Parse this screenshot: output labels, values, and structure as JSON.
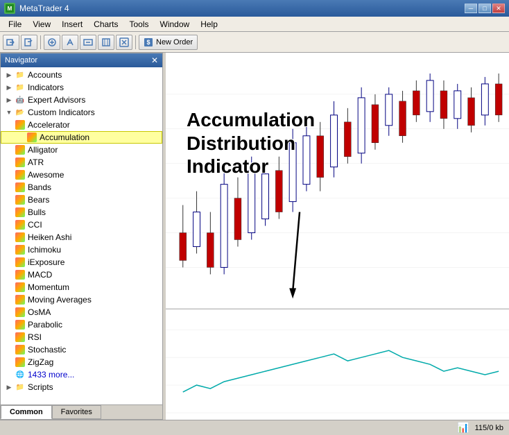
{
  "app": {
    "title": "MetaTrader 4",
    "icon": "MT4"
  },
  "titleBar": {
    "title": "MetaTrader 4",
    "minimizeLabel": "─",
    "maximizeLabel": "□",
    "closeLabel": "✕"
  },
  "menuBar": {
    "items": [
      "File",
      "View",
      "Insert",
      "Charts",
      "Tools",
      "Window",
      "Help"
    ]
  },
  "toolbar": {
    "newOrderLabel": "New Order"
  },
  "navigator": {
    "title": "Navigator",
    "closeLabel": "✕",
    "tabs": [
      "Common",
      "Favorites"
    ],
    "activeTab": "Common",
    "tree": [
      {
        "id": "accounts",
        "label": "Accounts",
        "level": 0,
        "type": "folder",
        "expanded": true
      },
      {
        "id": "indicators",
        "label": "Indicators",
        "level": 0,
        "type": "folder",
        "expanded": false
      },
      {
        "id": "expert-advisors",
        "label": "Expert Advisors",
        "level": 0,
        "type": "folder",
        "expanded": false
      },
      {
        "id": "custom-indicators",
        "label": "Custom Indicators",
        "level": 0,
        "type": "folder",
        "expanded": true
      },
      {
        "id": "accelerator",
        "label": "Accelerator",
        "level": 1,
        "type": "indicator"
      },
      {
        "id": "accumulation",
        "label": "Accumulation",
        "level": 1,
        "type": "indicator",
        "highlighted": true
      },
      {
        "id": "alligator",
        "label": "Alligator",
        "level": 1,
        "type": "indicator"
      },
      {
        "id": "atr",
        "label": "ATR",
        "level": 1,
        "type": "indicator"
      },
      {
        "id": "awesome",
        "label": "Awesome",
        "level": 1,
        "type": "indicator"
      },
      {
        "id": "bands",
        "label": "Bands",
        "level": 1,
        "type": "indicator"
      },
      {
        "id": "bears",
        "label": "Bears",
        "level": 1,
        "type": "indicator"
      },
      {
        "id": "bulls",
        "label": "Bulls",
        "level": 1,
        "type": "indicator"
      },
      {
        "id": "cci",
        "label": "CCI",
        "level": 1,
        "type": "indicator"
      },
      {
        "id": "heiken-ashi",
        "label": "Heiken Ashi",
        "level": 1,
        "type": "indicator"
      },
      {
        "id": "ichimoku",
        "label": "Ichimoku",
        "level": 1,
        "type": "indicator"
      },
      {
        "id": "iexposure",
        "label": "iExposure",
        "level": 1,
        "type": "indicator"
      },
      {
        "id": "macd",
        "label": "MACD",
        "level": 1,
        "type": "indicator"
      },
      {
        "id": "momentum",
        "label": "Momentum",
        "level": 1,
        "type": "indicator"
      },
      {
        "id": "moving-averages",
        "label": "Moving Averages",
        "level": 1,
        "type": "indicator"
      },
      {
        "id": "osma",
        "label": "OsMA",
        "level": 1,
        "type": "indicator"
      },
      {
        "id": "parabolic",
        "label": "Parabolic",
        "level": 1,
        "type": "indicator"
      },
      {
        "id": "rsi",
        "label": "RSI",
        "level": 1,
        "type": "indicator"
      },
      {
        "id": "stochastic",
        "label": "Stochastic",
        "level": 1,
        "type": "indicator"
      },
      {
        "id": "zigzag",
        "label": "ZigZag",
        "level": 1,
        "type": "indicator"
      },
      {
        "id": "more",
        "label": "1433 more...",
        "level": 1,
        "type": "more"
      },
      {
        "id": "scripts",
        "label": "Scripts",
        "level": 0,
        "type": "folder",
        "expanded": false
      }
    ]
  },
  "chart": {
    "annotation": {
      "line1": "Accumulation",
      "line2": "Distribution",
      "line3": "Indicator"
    }
  },
  "statusBar": {
    "memory": "115/0 kb"
  }
}
